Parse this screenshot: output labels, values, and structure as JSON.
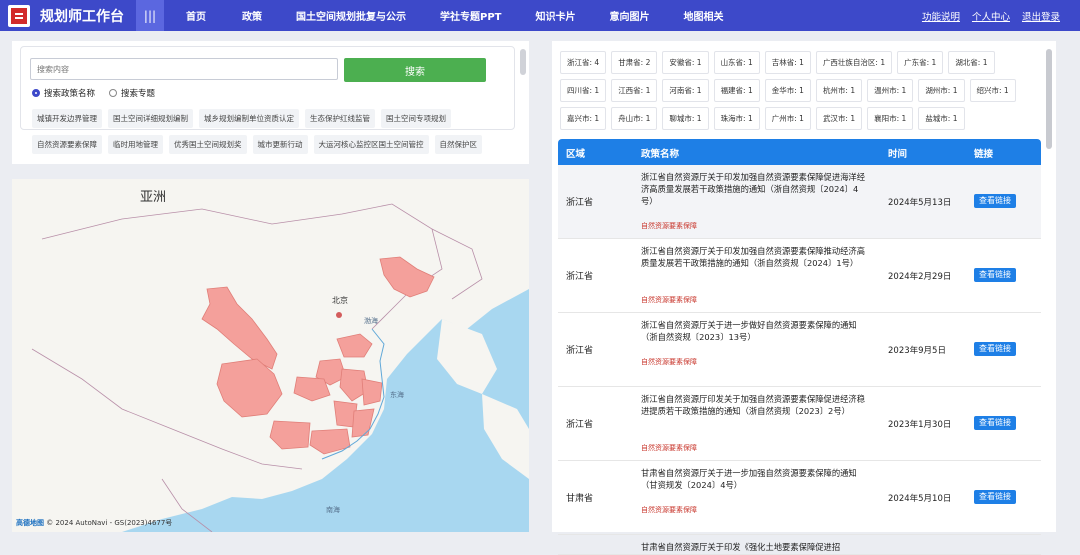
{
  "header": {
    "app_title": "规划师工作台",
    "menu_glyph": "|||",
    "nav": [
      "首页",
      "政策",
      "国土空间规划批复与公示",
      "学社专题PPT",
      "知识卡片",
      "意向图片",
      "地图相关"
    ],
    "right": [
      "功能说明",
      "个人中心",
      "退出登录"
    ]
  },
  "search": {
    "placeholder": "搜索内容",
    "button_label": "搜索",
    "radio_options": [
      "搜索政策名称",
      "搜索专题"
    ],
    "selected_radio": 0,
    "tags": [
      "城镇开发边界管理",
      "国土空间详细规划编制",
      "城乡规划编制单位资质认定",
      "生态保护红线监管",
      "国土空间专项规划",
      "自然资源要素保障",
      "临时用地管理",
      "优秀国土空间规划奖",
      "城市更新行动",
      "大运河核心监控区国土空间管控",
      "自然保护区"
    ]
  },
  "map": {
    "label_asia": "亚洲",
    "label_beijing": "北京",
    "label_bohai": "渤海",
    "label_donghai": "东海",
    "label_nanhai": "南海",
    "attribution": "© 2024 AutoNavi - GS(2023)4677号",
    "logo_text": "高德地图",
    "highlight_color": "#f4a09b"
  },
  "filters": [
    "浙江省: 4",
    "甘肃省: 2",
    "安徽省: 1",
    "山东省: 1",
    "吉林省: 1",
    "广西壮族自治区: 1",
    "广东省: 1",
    "湖北省: 1",
    "四川省: 1",
    "江西省: 1",
    "河南省: 1",
    "福建省: 1",
    "金华市: 1",
    "杭州市: 1",
    "温州市: 1",
    "湖州市: 1",
    "绍兴市: 1",
    "嘉兴市: 1",
    "舟山市: 1",
    "聊城市: 1",
    "珠海市: 1",
    "广州市: 1",
    "武汉市: 1",
    "襄阳市: 1",
    "盐城市: 1"
  ],
  "table": {
    "headers": [
      "区域",
      "政策名称",
      "时间",
      "链接"
    ],
    "rows": [
      {
        "region": "浙江省",
        "title": "浙江省自然资源厅关于印发加强自然资源要素保障促进海洋经济高质量发展若干政策措施的通知（浙自然资规〔2024〕4号）",
        "tag": "自然资源要素保障",
        "date": "2024年5月13日",
        "link": "查看链接"
      },
      {
        "region": "浙江省",
        "title": "浙江省自然资源厅关于印发加强自然资源要素保障推动经济高质量发展若干政策措施的通知（浙自然资规〔2024〕1号）",
        "tag": "自然资源要素保障",
        "date": "2024年2月29日",
        "link": "查看链接"
      },
      {
        "region": "浙江省",
        "title": "浙江省自然资源厅关于进一步做好自然资源要素保障的通知（浙自然资规〔2023〕13号）",
        "tag": "自然资源要素保障",
        "date": "2023年9月5日",
        "link": "查看链接"
      },
      {
        "region": "浙江省",
        "title": "浙江省自然资源厅印发关于加强自然资源要素保障促进经济稳进提质若干政策措施的通知（浙自然资规〔2023〕2号）",
        "tag": "自然资源要素保障",
        "date": "2023年1月30日",
        "link": "查看链接"
      },
      {
        "region": "甘肃省",
        "title": "甘肃省自然资源厅关于进一步加强自然资源要素保障的通知（甘资规发〔2024〕4号）",
        "tag": "自然资源要素保障",
        "date": "2024年5月10日",
        "link": "查看链接"
      },
      {
        "region": "",
        "title": "甘肃省自然资源厅关于印发《强化土地要素保障促进招",
        "tag": "",
        "date": "",
        "link": ""
      }
    ]
  }
}
